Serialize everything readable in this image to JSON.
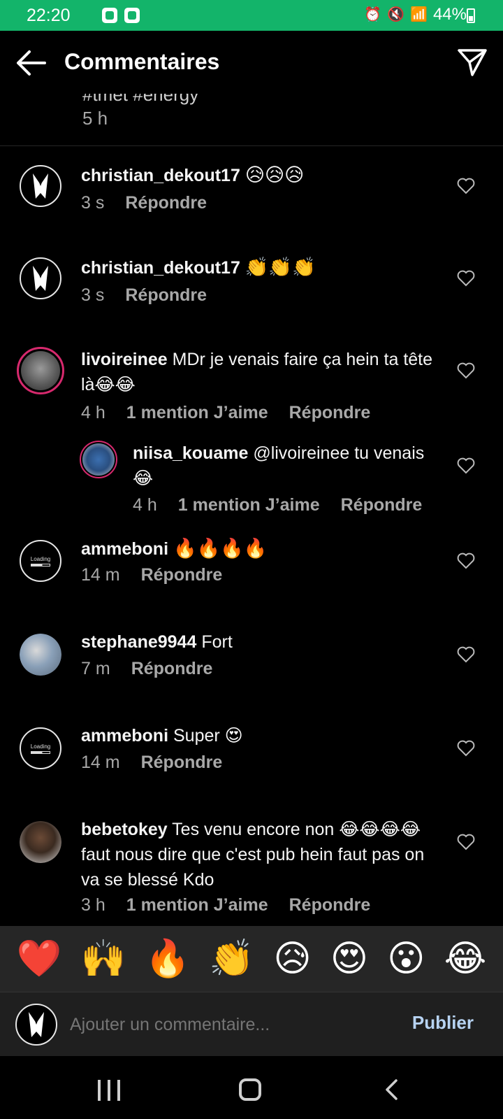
{
  "status_bar": {
    "time": "22:20",
    "battery": "44%"
  },
  "header": {
    "title": "Commentaires"
  },
  "caption": {
    "partial_text": "#tmet #energy",
    "time": "5 h"
  },
  "comments": [
    {
      "user": "christian_dekout17",
      "text": "😥😥😥",
      "time": "3 s",
      "likes": "",
      "reply": "Répondre",
      "avatar": "logo"
    },
    {
      "user": "christian_dekout17",
      "text": "👏👏👏",
      "time": "3 s",
      "likes": "",
      "reply": "Répondre",
      "avatar": "logo"
    },
    {
      "user": "livoireinee",
      "text": "MDr je venais faire ça hein ta tête là😂😂",
      "time": "4 h",
      "likes": "1 mention J’aime",
      "reply": "Répondre",
      "avatar": "photo"
    },
    {
      "user": "niisa_kouame",
      "text": "@livoireinee tu venais 😂",
      "time": "4 h",
      "likes": "1 mention J’aime",
      "reply": "Répondre",
      "avatar": "photo"
    },
    {
      "user": "ammeboni",
      "text": "🔥🔥🔥🔥",
      "time": "14 m",
      "likes": "",
      "reply": "Répondre",
      "avatar": "loading"
    },
    {
      "user": "stephane9944",
      "text": "Fort",
      "time": "7 m",
      "likes": "",
      "reply": "Répondre",
      "avatar": "photo"
    },
    {
      "user": "ammeboni",
      "text": "Super 😍",
      "time": "14 m",
      "likes": "",
      "reply": "Répondre",
      "avatar": "loading"
    },
    {
      "user": "bebetokey",
      "text": "Tes venu encore non 😂😂😂😂 faut nous dire que c'est pub hein faut pas on va se blessé Kdo",
      "time": "3 h",
      "likes": "1 mention J’aime",
      "reply": "Répondre",
      "avatar": "photo"
    }
  ],
  "avatar_loading_text": "Loading",
  "reactions": [
    "❤️",
    "🙌",
    "🔥",
    "👏",
    "😥",
    "😍",
    "😮",
    "😂"
  ],
  "composer": {
    "placeholder": "Ajouter un commentaire...",
    "publish": "Publier"
  },
  "colors": {
    "status_bar": "#13b46a",
    "publish": "#b7d3f2",
    "meta": "#a8a8a8"
  }
}
